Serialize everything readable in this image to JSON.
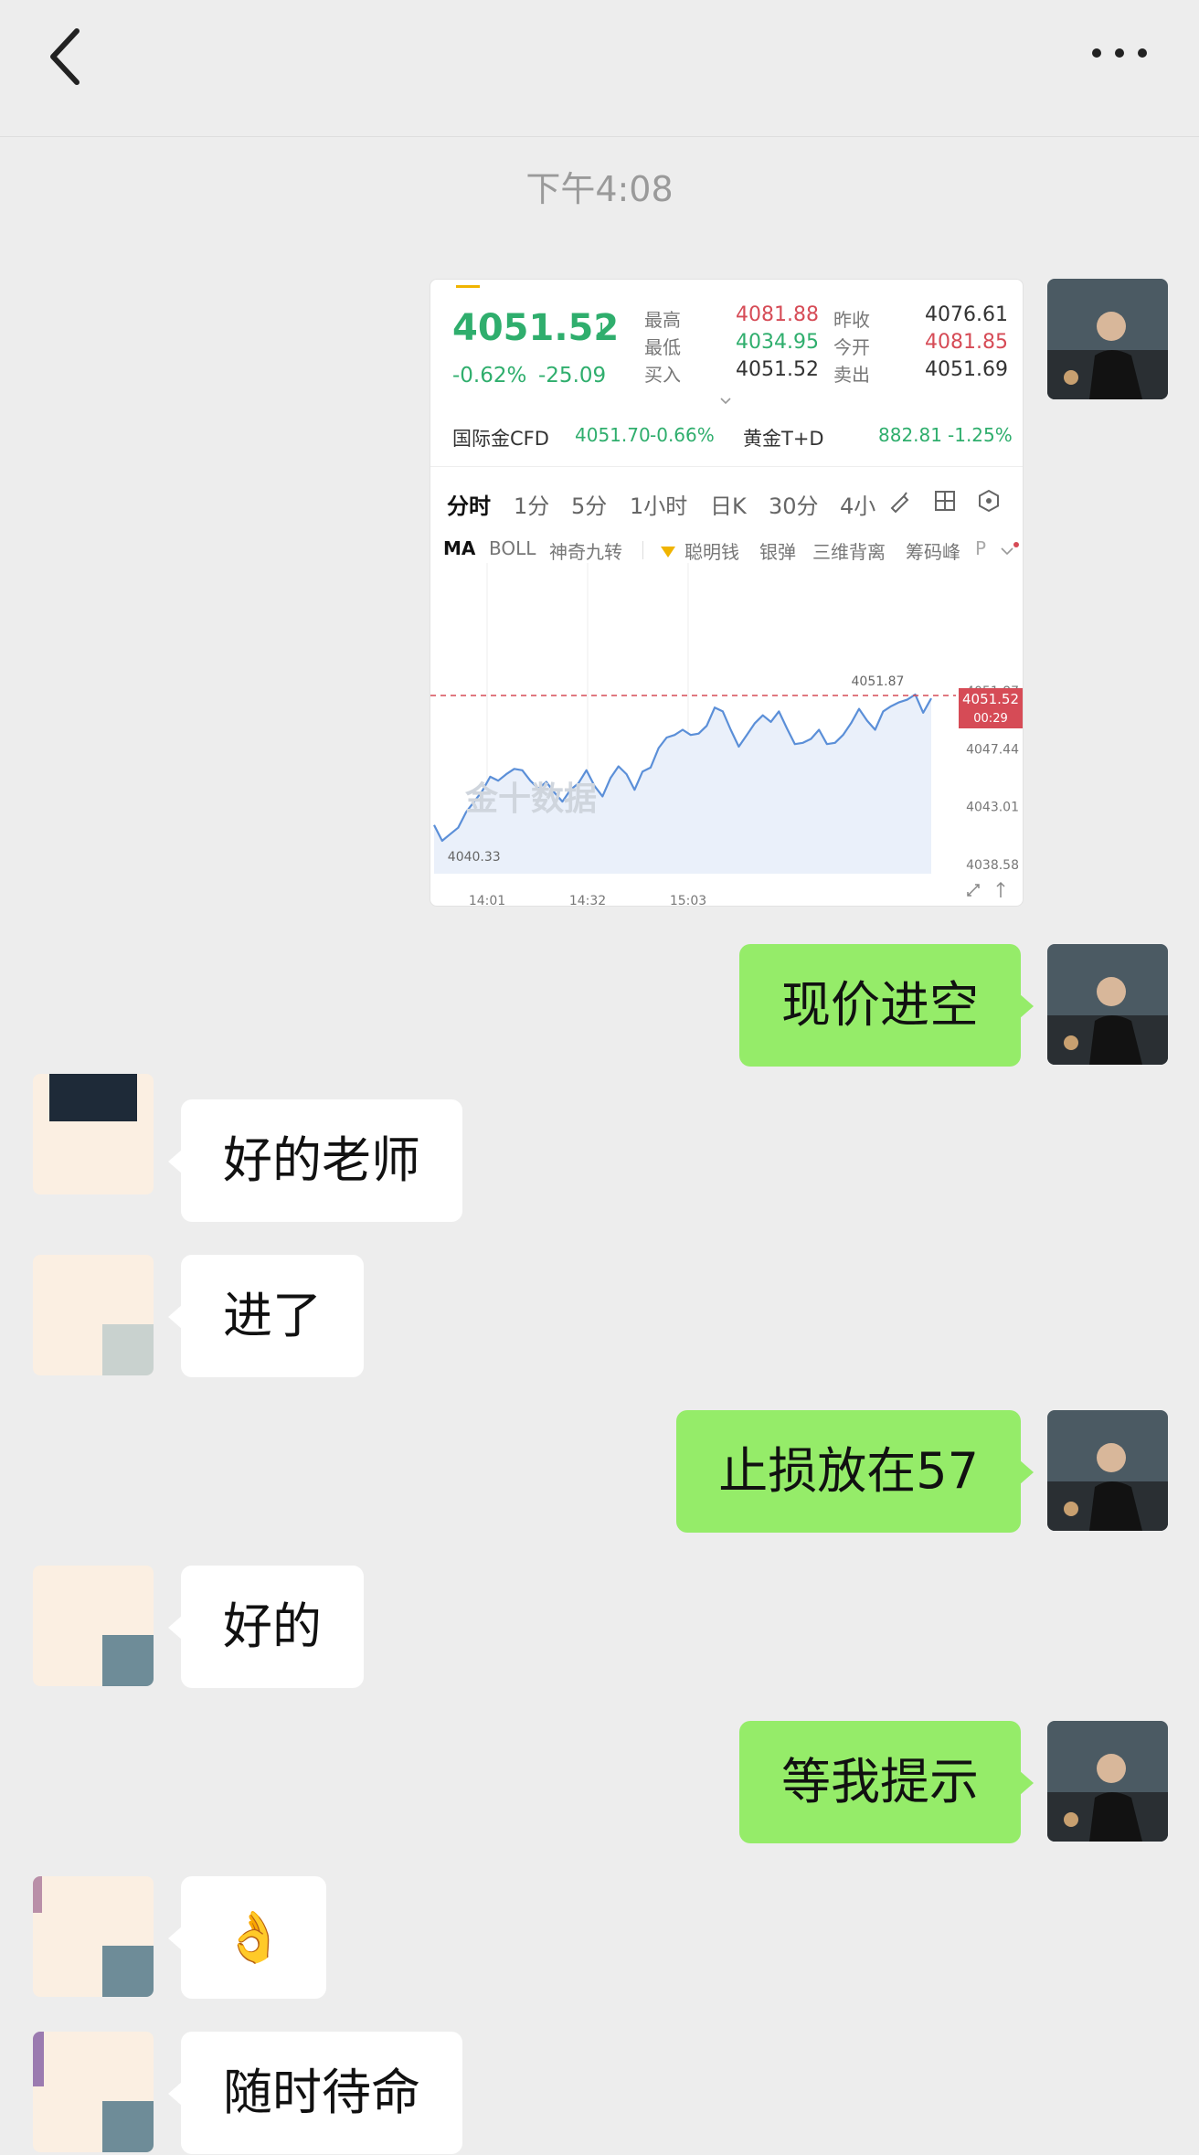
{
  "timestamp": "下午4:08",
  "card": {
    "price": "4051.52",
    "price_arrow": "↓",
    "change_pct": "-0.62%",
    "change_abs": "-25.09",
    "stats": {
      "high_label": "最高",
      "high": "4081.88",
      "low_label": "最低",
      "low": "4034.95",
      "buy_label": "买入",
      "buy": "4051.52",
      "prev_close_label": "昨收",
      "prev_close": "4076.61",
      "open_label": "今开",
      "open": "4081.85",
      "sell_label": "卖出",
      "sell": "4051.69"
    },
    "cfd_label": "国际金CFD",
    "cfd_value": "4051.70",
    "cfd_pct": "-0.66%",
    "td_label": "黄金T+D",
    "td_value": "882.81",
    "td_pct": "-1.25%",
    "tabs": [
      "分时",
      "1分",
      "5分",
      "1小时",
      "日K",
      "30分",
      "4小"
    ],
    "indicators": [
      "MA",
      "BOLL",
      "神奇九转",
      "聪明钱",
      "银弹",
      "三维背离",
      "筹码峰",
      "P"
    ],
    "watermark": "金十数据",
    "current_tag": "4051.52",
    "countdown": "00:29",
    "high_marker": "4051.87",
    "low_marker": "4040.33"
  },
  "chart_data": {
    "type": "line",
    "x_ticks": [
      "14:01",
      "14:32",
      "15:03"
    ],
    "y_ticks": [
      "4051.87",
      "4047.44",
      "4043.01",
      "4038.58"
    ],
    "ylim": [
      4038.58,
      4051.87
    ],
    "values": [
      4041.6,
      4040.4,
      4040.9,
      4041.4,
      4042.6,
      4043.4,
      4044.2,
      4045.3,
      4045.0,
      4045.5,
      4045.9,
      4045.8,
      4045.0,
      4044.4,
      4044.9,
      4044.1,
      4043.4,
      4044.3,
      4044.8,
      4045.8,
      4044.6,
      4043.8,
      4045.2,
      4046.1,
      4045.5,
      4044.3,
      4045.7,
      4046.0,
      4047.5,
      4048.3,
      4048.5,
      4048.9,
      4048.5,
      4048.6,
      4049.2,
      4050.6,
      4050.3,
      4048.9,
      4047.6,
      4048.5,
      4049.4,
      4050.0,
      4049.5,
      4050.3,
      4049.0,
      4047.8,
      4047.9,
      4048.2,
      4048.9,
      4047.8,
      4047.9,
      4048.5,
      4049.4,
      4050.5,
      4049.6,
      4048.9,
      4050.3,
      4050.7,
      4051.0,
      4051.2,
      4051.6,
      4050.2,
      4051.3
    ],
    "colors": {
      "line": "#5b8fd8",
      "fill": "#e8eefa",
      "ref_line": "#d64b56"
    }
  },
  "messages": [
    {
      "side": "me",
      "text": "现价进空"
    },
    {
      "side": "other",
      "text": "好的老师"
    },
    {
      "side": "other",
      "text": "进了"
    },
    {
      "side": "me",
      "text": "止损放在57"
    },
    {
      "side": "other",
      "text": "好的"
    },
    {
      "side": "me",
      "text": "等我提示"
    },
    {
      "side": "other",
      "text": "👌"
    },
    {
      "side": "other",
      "text": "随时待命"
    }
  ]
}
